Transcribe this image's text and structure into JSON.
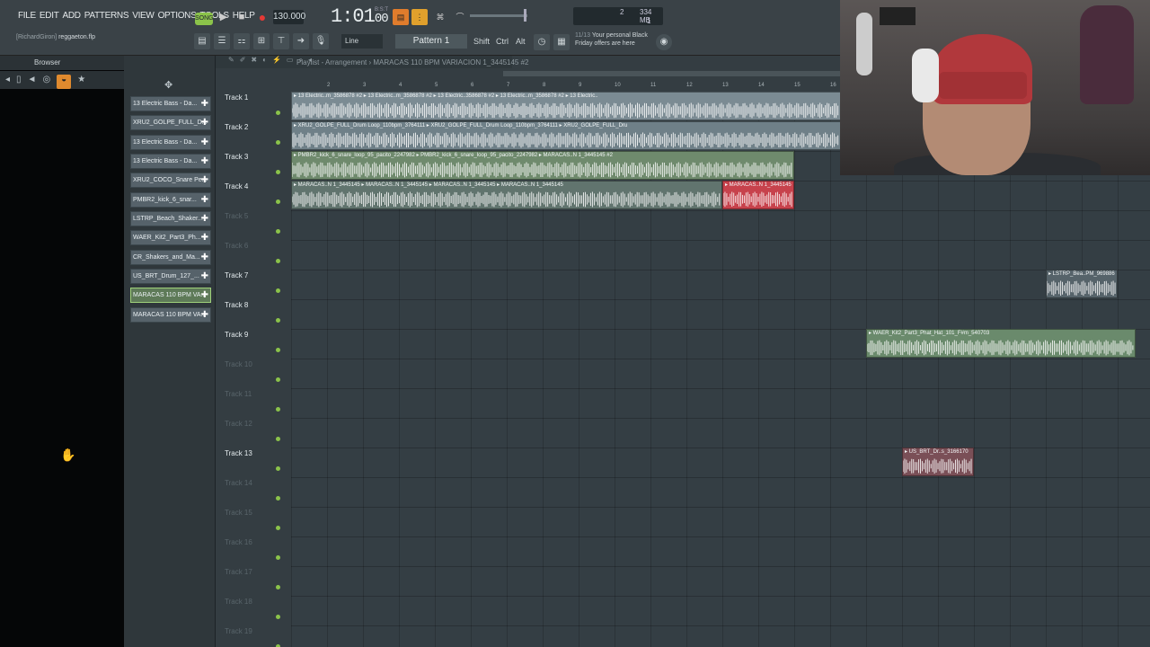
{
  "menu": [
    "FILE",
    "EDIT",
    "ADD",
    "PATTERNS",
    "VIEW",
    "OPTIONS",
    "TOOLS",
    "HELP"
  ],
  "transport": {
    "song_label": "SONG",
    "tempo": "130.000",
    "time": "1:01",
    "time_sub": "00",
    "time_unit": "B:S:T"
  },
  "monitor": {
    "value": "2",
    "memory": "334 MB",
    "voices": "1"
  },
  "hint": {
    "user": "[RichardGiron]",
    "file": "reggaeton.flp"
  },
  "toolbar": {
    "snap": "Line",
    "pattern": "Pattern 1",
    "shift": "Shift",
    "ctrl": "Ctrl",
    "alt": "Alt"
  },
  "news": {
    "count": "11/13",
    "line1": "Your personal Black",
    "line2": "Friday offers are here"
  },
  "browser": {
    "title": "Browser"
  },
  "channels": [
    {
      "name": "13 Electric Bass - Da...",
      "selected": false
    },
    {
      "name": "XRU2_GOLPE_FULL_D...",
      "selected": false
    },
    {
      "name": "13 Electric Bass - Da...",
      "selected": false
    },
    {
      "name": "13 Electric Bass - Da...",
      "selected": false
    },
    {
      "name": "XRU2_COCO_Snare Pe...",
      "selected": false
    },
    {
      "name": "PMBR2_kick_6_snar...",
      "selected": false
    },
    {
      "name": "LSTRP_Beach_Shaker...",
      "selected": false
    },
    {
      "name": "WAER_Kit2_Part3_Ph...",
      "selected": false
    },
    {
      "name": "CR_Shakers_and_Ma...",
      "selected": false
    },
    {
      "name": "US_BRT_Drum_127_...",
      "selected": false
    },
    {
      "name": "MARACAS 110 BPM VA...",
      "selected": true
    },
    {
      "name": "MARACAS 110 BPM VA...",
      "selected": false
    }
  ],
  "playlist": {
    "title": "Playlist - Arrangement",
    "subtitle": "MARACAS 110 BPM VARIACION 1_3445145 #2",
    "ruler": [
      "2",
      "3",
      "4",
      "5",
      "6",
      "7",
      "8",
      "9",
      "10",
      "11",
      "12",
      "13",
      "14",
      "15",
      "16"
    ],
    "tracks": [
      {
        "name": "Track 1",
        "empty": false
      },
      {
        "name": "Track 2",
        "empty": false
      },
      {
        "name": "Track 3",
        "empty": false
      },
      {
        "name": "Track 4",
        "empty": false
      },
      {
        "name": "Track 5",
        "empty": true
      },
      {
        "name": "Track 6",
        "empty": true
      },
      {
        "name": "Track 7",
        "empty": false
      },
      {
        "name": "Track 8",
        "empty": false
      },
      {
        "name": "Track 9",
        "empty": false
      },
      {
        "name": "Track 10",
        "empty": true
      },
      {
        "name": "Track 11",
        "empty": true
      },
      {
        "name": "Track 12",
        "empty": true
      },
      {
        "name": "Track 13",
        "empty": false
      },
      {
        "name": "Track 14",
        "empty": true
      },
      {
        "name": "Track 15",
        "empty": true
      },
      {
        "name": "Track 16",
        "empty": true
      },
      {
        "name": "Track 17",
        "empty": true
      },
      {
        "name": "Track 18",
        "empty": true
      },
      {
        "name": "Track 19",
        "empty": true
      }
    ],
    "clips": [
      {
        "track": 0,
        "start": 0,
        "len": 15.3,
        "color": "#7b8b93",
        "label": "13 Electric..m_3586878 #2 ▸ 13 Electric..m_3586878 #2 ▸ 13 Electric..3586878 #2 ▸ 13 Electric..m_3586878 #2 ▸ 13 Electric.."
      },
      {
        "track": 1,
        "start": 0,
        "len": 15.3,
        "color": "#6f8088",
        "label": "XRU2_GOLPE_FULL_Drum Loop_110bpm_3764111 ▸ XRU2_GOLPE_FULL_Drum Loop_110bpm_3764111 ▸ XRU2_GOLPE_FULL_Dru"
      },
      {
        "track": 2,
        "start": 0,
        "len": 14,
        "color": "#6f8a6d",
        "label": "PMBR2_kick_6_snare_loop_95_pacito_2247982 ▸ PMBR2_kick_6_snare_loop_95_pacito_2247982 ▸ MARACAS..N 1_3445145 #2"
      },
      {
        "track": 3,
        "start": 0,
        "len": 12,
        "color": "#61746e",
        "label": "MARACAS..N 1_3445145 ▸ MARACAS..N 1_3445145 ▸ MARACAS..N 1_3445145 ▸ MARACAS..N 1_3445145"
      },
      {
        "track": 3,
        "start": 12,
        "len": 2,
        "color": "#c7424c",
        "label": "MARACAS..N 1_3445145"
      },
      {
        "track": 6,
        "start": 21,
        "len": 2,
        "color": "#56636a",
        "label": "LSTRP_Bea..PM_969886"
      },
      {
        "track": 8,
        "start": 16,
        "len": 7.5,
        "color": "#6a8a6c",
        "label": "WAER_Kit2_Part3_Phat_Hat_101_F#m_540703"
      },
      {
        "track": 12,
        "start": 17,
        "len": 2,
        "color": "#7a4f57",
        "label": "US_BRT_Dr..s_3166170"
      }
    ]
  },
  "colors": {
    "accent": "#8bc34a",
    "record": "#e53935",
    "selected_clip": "#c7424c"
  }
}
